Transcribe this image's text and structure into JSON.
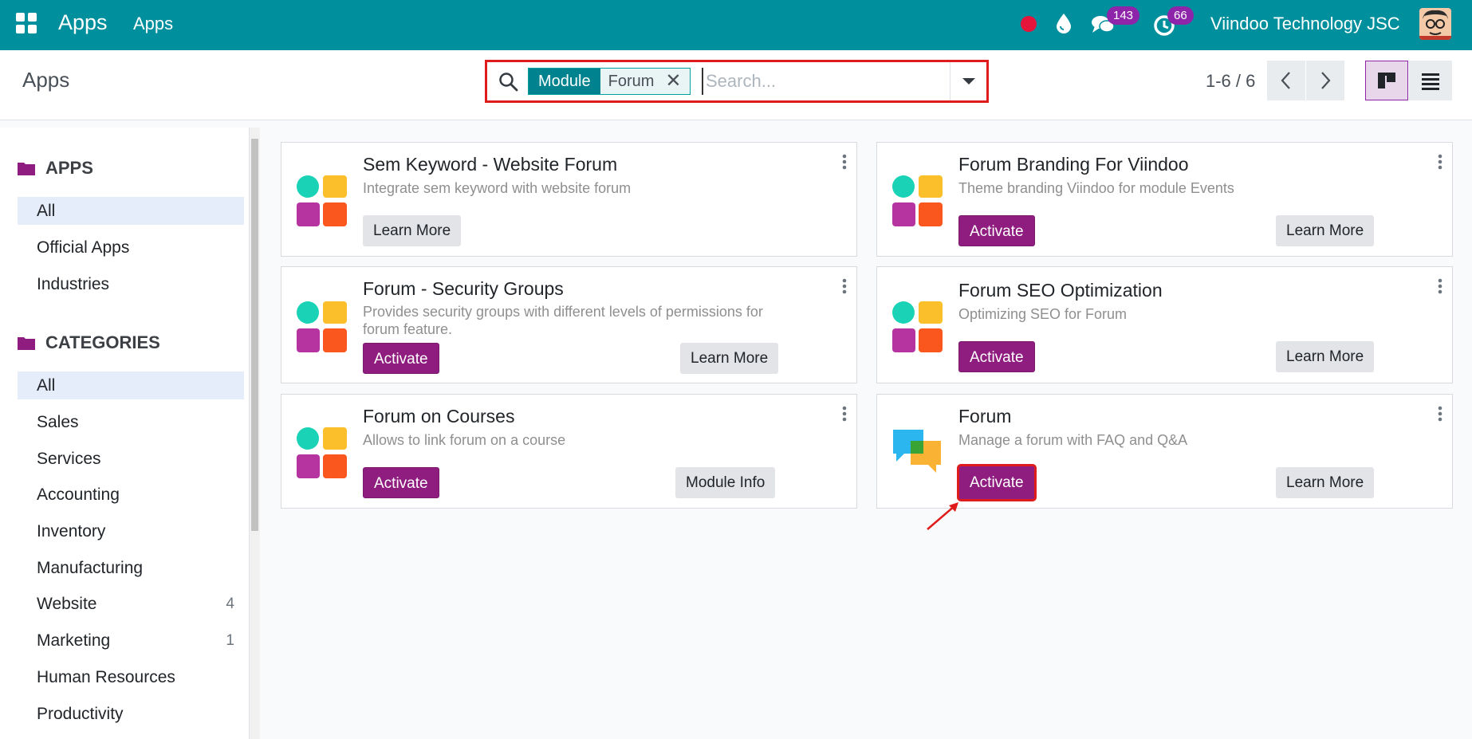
{
  "navbar": {
    "brand": "Apps",
    "menu": "Apps",
    "messages_count": "143",
    "activities_count": "66",
    "company": "Viindoo Technology JSC"
  },
  "control_panel": {
    "breadcrumb": "Apps",
    "facet_category": "Module",
    "facet_value": "Forum",
    "search_placeholder": "Search...",
    "pager": "1-6 / 6"
  },
  "sidebar": {
    "apps_heading": "APPS",
    "apps_items": [
      "All",
      "Official Apps",
      "Industries"
    ],
    "categories_heading": "CATEGORIES",
    "categories": [
      {
        "label": "All",
        "count": ""
      },
      {
        "label": "Sales",
        "count": ""
      },
      {
        "label": "Services",
        "count": ""
      },
      {
        "label": "Accounting",
        "count": ""
      },
      {
        "label": "Inventory",
        "count": ""
      },
      {
        "label": "Manufacturing",
        "count": ""
      },
      {
        "label": "Website",
        "count": "4"
      },
      {
        "label": "Marketing",
        "count": "1"
      },
      {
        "label": "Human Resources",
        "count": ""
      },
      {
        "label": "Productivity",
        "count": ""
      }
    ]
  },
  "cards": [
    {
      "title": "Sem Keyword - Website Forum",
      "desc": "Integrate sem keyword with website forum",
      "primary": "",
      "secondary": "Learn More"
    },
    {
      "title": "Forum Branding For Viindoo",
      "desc": "Theme branding Viindoo for module Events",
      "primary": "Activate",
      "secondary": "Learn More"
    },
    {
      "title": "Forum - Security Groups",
      "desc": "Provides security groups with different levels of permissions for forum feature.",
      "primary": "Activate",
      "secondary": "Learn More"
    },
    {
      "title": "Forum SEO Optimization",
      "desc": "Optimizing SEO for Forum",
      "primary": "Activate",
      "secondary": "Learn More"
    },
    {
      "title": "Forum on Courses",
      "desc": "Allows to link forum on a course",
      "primary": "Activate",
      "secondary": "Module Info"
    },
    {
      "title": "Forum",
      "desc": "Manage a forum with FAQ and Q&A",
      "primary": "Activate",
      "secondary": "Learn More"
    }
  ],
  "icons": {
    "apps": "grid-icon",
    "record": "record-dot-icon",
    "drop": "drop-icon",
    "chat": "chat-icon",
    "clock": "clock-icon",
    "search": "search-icon",
    "close": "close-icon",
    "caret": "caret-down-icon"
  },
  "colors": {
    "navbar": "#008f9c",
    "primary_button": "#8f1d7f",
    "highlight": "#e01b1b"
  }
}
